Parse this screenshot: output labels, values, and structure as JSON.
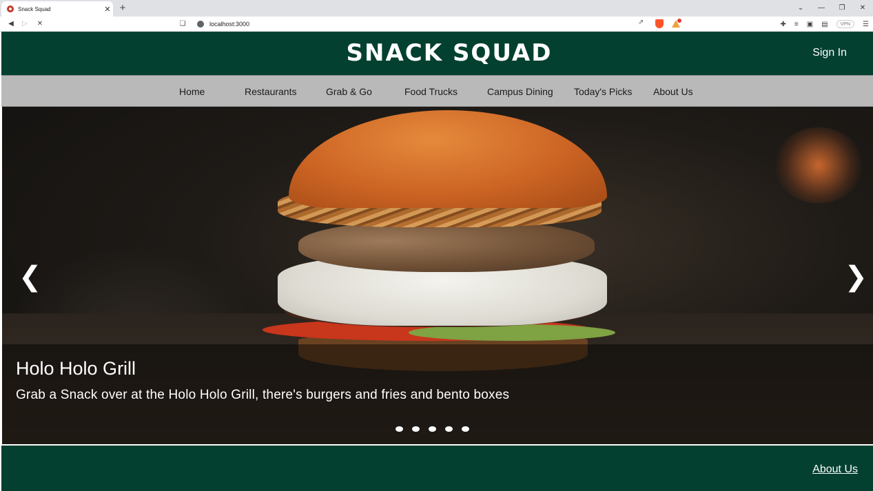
{
  "browser": {
    "tab_title": "Snack Squad",
    "new_tab": "+",
    "tab_close": "✕",
    "url": "localhost:3000",
    "vpn": "VPN",
    "win_minimize": "—",
    "win_restore": "❐",
    "win_close": "✕",
    "win_chevron": "⌄"
  },
  "header": {
    "logo": "SNACK SQUAD",
    "sign_in": "Sign In"
  },
  "nav": {
    "items": [
      "Home",
      "Restaurants",
      "Grab & Go",
      "Food Trucks",
      "Campus Dining",
      "Today's Picks",
      "About Us"
    ]
  },
  "carousel": {
    "title": "Holo Holo Grill",
    "caption": "Grab a Snack over at the Holo Holo Grill, there's burgers and fries and bento boxes",
    "prev": "❮",
    "next": "❯",
    "slide_count": 5,
    "active_index": 0
  },
  "footer": {
    "about": "About Us"
  },
  "colors": {
    "brand_green": "#034030",
    "nav_gray": "#b9b9b9"
  }
}
